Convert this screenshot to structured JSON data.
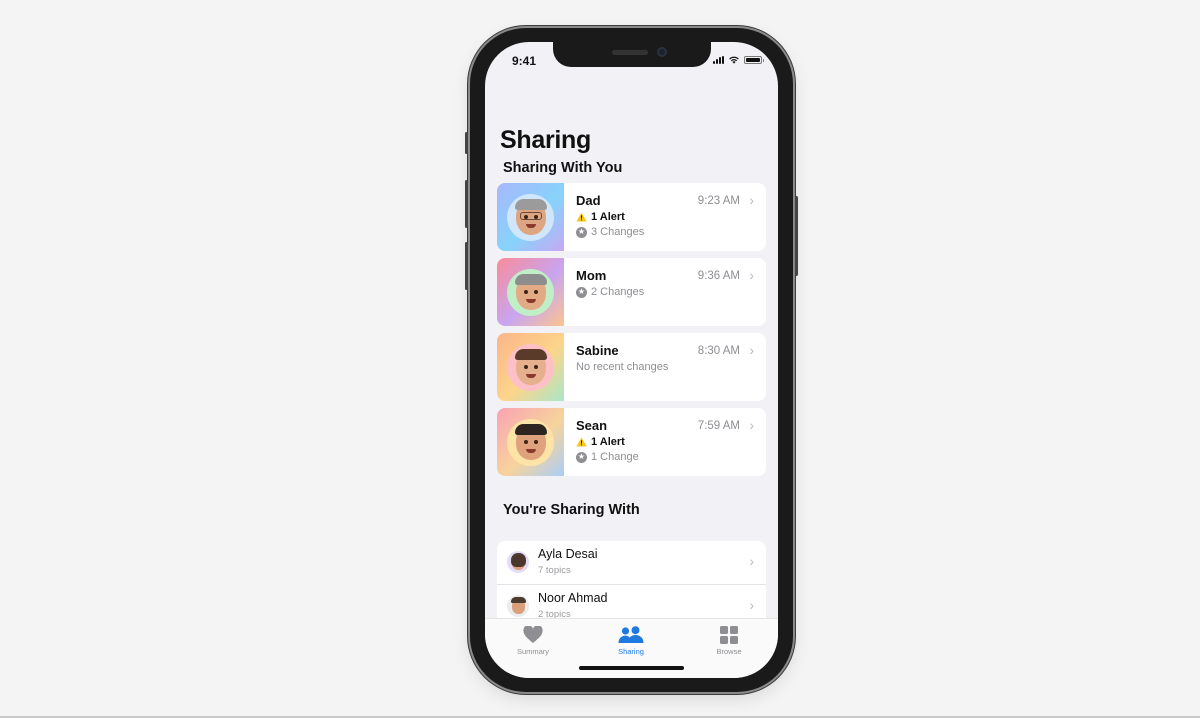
{
  "status_bar": {
    "time": "9:41"
  },
  "header": {
    "title": "Sharing"
  },
  "sharing_with_you": {
    "title": "Sharing With You",
    "people": [
      {
        "name": "Dad",
        "time": "9:23 AM",
        "alert": "1 Alert",
        "changes": "3 Changes",
        "note": null,
        "gradient": [
          "#a9b7fb",
          "#86d3fb",
          "#c7a8f2"
        ],
        "circle": "#cfe6fb"
      },
      {
        "name": "Mom",
        "time": "9:36 AM",
        "alert": null,
        "changes": "2 Changes",
        "note": null,
        "gradient": [
          "#f98b9a",
          "#c8a5f0",
          "#fbc48f"
        ],
        "circle": "#bfeec7"
      },
      {
        "name": "Sabine",
        "time": "8:30 AM",
        "alert": null,
        "changes": null,
        "note": "No recent changes",
        "gradient": [
          "#fbb489",
          "#fcd58a",
          "#a9e6c8"
        ],
        "circle": "#fcc0c6"
      },
      {
        "name": "Sean",
        "time": "7:59 AM",
        "alert": "1 Alert",
        "changes": "1 Change",
        "note": null,
        "gradient": [
          "#f9a2b3",
          "#f7d39c",
          "#a9cef8"
        ],
        "circle": "#fde3a6"
      }
    ]
  },
  "youre_sharing_with": {
    "title": "You're Sharing With",
    "people": [
      {
        "name": "Ayla Desai",
        "topics": "7 topics",
        "circle": "#e4dcf7"
      },
      {
        "name": "Noor Ahmad",
        "topics": "2 topics",
        "circle": "#ececec"
      }
    ]
  },
  "tab_bar": {
    "tabs": [
      {
        "label": "Summary",
        "icon": "heart-icon",
        "active": false
      },
      {
        "label": "Sharing",
        "icon": "people-icon",
        "active": true
      },
      {
        "label": "Browse",
        "icon": "grid-icon",
        "active": false
      }
    ]
  },
  "colors": {
    "accent": "#1f7ae0",
    "background": "#f2f2f6",
    "warning": "#f5c518",
    "secondary_text": "#8e8e93"
  }
}
